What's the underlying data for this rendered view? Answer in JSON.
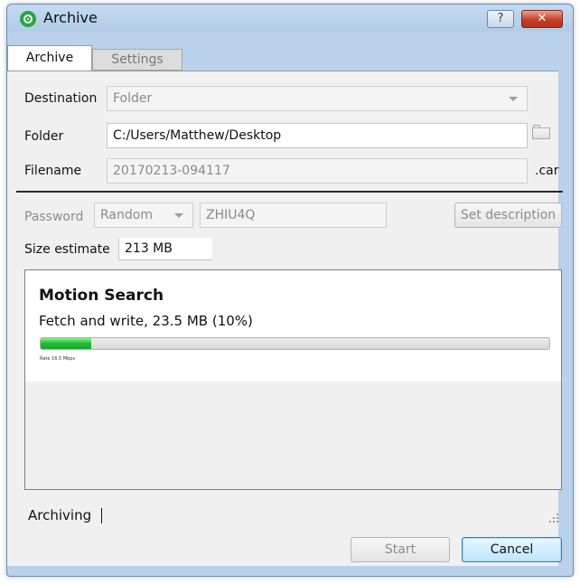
{
  "window": {
    "title": "Archive",
    "help_label": "?",
    "close_label": "✕"
  },
  "tabs": [
    {
      "label": "Archive",
      "selected": true
    },
    {
      "label": "Settings",
      "selected": false
    }
  ],
  "form": {
    "destination_label": "Destination",
    "destination_value": "Folder",
    "folder_label": "Folder",
    "folder_value": "C:/Users/Matthew/Desktop",
    "filename_label": "Filename",
    "filename_value": "20170213-094117",
    "filename_ext": ".car",
    "password_label": "Password",
    "password_mode": "Random",
    "password_value": "ZHIU4Q",
    "set_description_label": "Set description",
    "size_estimate_label": "Size estimate",
    "size_estimate_value": "213 MB"
  },
  "task": {
    "title": "Motion Search",
    "status": "Fetch and write, 23.5 MB (10%)",
    "progress_fraction": 0.1,
    "rate": "Rate 16.5 Mbps"
  },
  "footer": {
    "status": "Archiving",
    "start_label": "Start",
    "cancel_label": "Cancel"
  },
  "colors": {
    "progress_fill": "#1fbd32",
    "close_button": "#c4412c",
    "window_frame": "#b9d1ea"
  },
  "icons": {
    "app": "eye-icon",
    "folder": "folder-icon",
    "resize": "resize-grip-icon"
  }
}
